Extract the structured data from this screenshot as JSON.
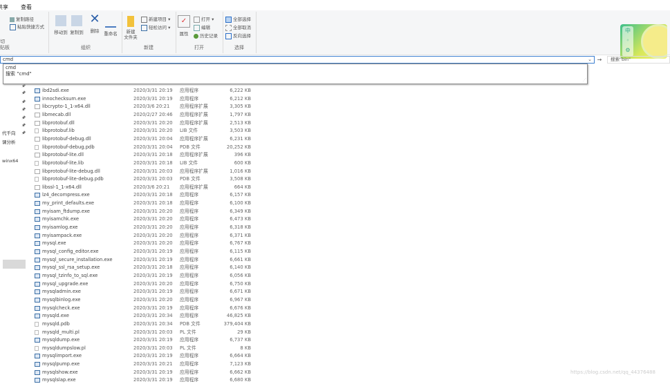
{
  "tabs": [
    "共享",
    "查看"
  ],
  "ribbon": {
    "clipboard": {
      "copy_path": "复制路径",
      "paste_shortcut": "粘贴快捷方式",
      "cut": "剪切",
      "label": "贴板"
    },
    "organize": {
      "move_to": "移动到",
      "copy_to": "复制到",
      "delete": "删除",
      "rename": "重命名",
      "label": "组织"
    },
    "new": {
      "new_folder_1": "新建",
      "new_folder_2": "文件夹",
      "new_item": "新建项目 ▾",
      "easy_access": "轻松访问 ▾",
      "label": "新建"
    },
    "open": {
      "properties": "属性",
      "open": "打开 ▾",
      "edit": "编辑",
      "history": "历史记录",
      "label": "打开"
    },
    "select": {
      "select_all": "全部选择",
      "select_none": "全部取消",
      "invert": "反向选择",
      "label": "选择"
    }
  },
  "address": {
    "value": "cmd",
    "search_placeholder": "搜索\"bin\""
  },
  "suggestions": [
    "cmd",
    "搜索 \"cmd\""
  ],
  "nav_items": [
    "代千向",
    "课分析",
    "winx64"
  ],
  "files": [
    [
      "ibd2sdi.exe",
      "2020/3/31 20:19",
      "应用程序",
      "6,222 KB",
      "exe"
    ],
    [
      "innochecksum.exe",
      "2020/3/31 20:19",
      "应用程序",
      "6,212 KB",
      "exe"
    ],
    [
      "libcrypto-1_1-x64.dll",
      "2020/3/6 20:21",
      "应用程序扩展",
      "3,305 KB",
      "dll"
    ],
    [
      "libmecab.dll",
      "2020/2/27 20:46",
      "应用程序扩展",
      "1,797 KB",
      "dll"
    ],
    [
      "libprotobuf.dll",
      "2020/3/31 20:20",
      "应用程序扩展",
      "2,513 KB",
      "dll"
    ],
    [
      "libprotobuf.lib",
      "2020/3/31 20:20",
      "LIB 文件",
      "3,503 KB",
      "doc"
    ],
    [
      "libprotobuf-debug.dll",
      "2020/3/31 20:04",
      "应用程序扩展",
      "6,231 KB",
      "dll"
    ],
    [
      "libprotobuf-debug.pdb",
      "2020/3/31 20:04",
      "PDB 文件",
      "20,252 KB",
      "doc"
    ],
    [
      "libprotobuf-lite.dll",
      "2020/3/31 20:18",
      "应用程序扩展",
      "396 KB",
      "dll"
    ],
    [
      "libprotobuf-lite.lib",
      "2020/3/31 20:18",
      "LIB 文件",
      "600 KB",
      "doc"
    ],
    [
      "libprotobuf-lite-debug.dll",
      "2020/3/31 20:03",
      "应用程序扩展",
      "1,016 KB",
      "dll"
    ],
    [
      "libprotobuf-lite-debug.pdb",
      "2020/3/31 20:03",
      "PDB 文件",
      "3,508 KB",
      "doc"
    ],
    [
      "libssl-1_1-x64.dll",
      "2020/3/6 20:21",
      "应用程序扩展",
      "664 KB",
      "dll"
    ],
    [
      "lz4_decompress.exe",
      "2020/3/31 20:18",
      "应用程序",
      "6,157 KB",
      "exe"
    ],
    [
      "my_print_defaults.exe",
      "2020/3/31 20:18",
      "应用程序",
      "6,100 KB",
      "exe"
    ],
    [
      "myisam_ftdump.exe",
      "2020/3/31 20:20",
      "应用程序",
      "6,349 KB",
      "exe"
    ],
    [
      "myisamchk.exe",
      "2020/3/31 20:20",
      "应用程序",
      "6,473 KB",
      "exe"
    ],
    [
      "myisamlog.exe",
      "2020/3/31 20:20",
      "应用程序",
      "6,318 KB",
      "exe"
    ],
    [
      "myisampack.exe",
      "2020/3/31 20:20",
      "应用程序",
      "6,371 KB",
      "exe"
    ],
    [
      "mysql.exe",
      "2020/3/31 20:20",
      "应用程序",
      "6,767 KB",
      "exe"
    ],
    [
      "mysql_config_editor.exe",
      "2020/3/31 20:19",
      "应用程序",
      "6,115 KB",
      "exe"
    ],
    [
      "mysql_secure_installation.exe",
      "2020/3/31 20:19",
      "应用程序",
      "6,661 KB",
      "exe"
    ],
    [
      "mysql_ssl_rsa_setup.exe",
      "2020/3/31 20:18",
      "应用程序",
      "6,140 KB",
      "exe"
    ],
    [
      "mysql_tzinfo_to_sql.exe",
      "2020/3/31 20:19",
      "应用程序",
      "6,056 KB",
      "exe"
    ],
    [
      "mysql_upgrade.exe",
      "2020/3/31 20:20",
      "应用程序",
      "6,750 KB",
      "exe"
    ],
    [
      "mysqladmin.exe",
      "2020/3/31 20:19",
      "应用程序",
      "6,671 KB",
      "exe"
    ],
    [
      "mysqlbinlog.exe",
      "2020/3/31 20:20",
      "应用程序",
      "6,967 KB",
      "exe"
    ],
    [
      "mysqlcheck.exe",
      "2020/3/31 20:19",
      "应用程序",
      "6,676 KB",
      "exe"
    ],
    [
      "mysqld.exe",
      "2020/3/31 20:34",
      "应用程序",
      "46,825 KB",
      "exe"
    ],
    [
      "mysqld.pdb",
      "2020/3/31 20:34",
      "PDB 文件",
      "379,404 KB",
      "doc"
    ],
    [
      "mysqld_multi.pl",
      "2020/3/31 20:03",
      "PL 文件",
      "29 KB",
      "doc"
    ],
    [
      "mysqldump.exe",
      "2020/3/31 20:19",
      "应用程序",
      "6,737 KB",
      "exe"
    ],
    [
      "mysqldumpslow.pl",
      "2020/3/31 20:03",
      "PL 文件",
      "8 KB",
      "doc"
    ],
    [
      "mysqlimport.exe",
      "2020/3/31 20:19",
      "应用程序",
      "6,664 KB",
      "exe"
    ],
    [
      "mysqlpump.exe",
      "2020/3/31 20:21",
      "应用程序",
      "7,123 KB",
      "exe"
    ],
    [
      "mysqlshow.exe",
      "2020/3/31 20:19",
      "应用程序",
      "6,662 KB",
      "exe"
    ],
    [
      "mysqlslap.exe",
      "2020/3/31 20:19",
      "应用程序",
      "6,680 KB",
      "exe"
    ]
  ],
  "watermark": "https://blog.csdn.net/qq_44376488",
  "widget": {
    "ime_label": "中"
  }
}
